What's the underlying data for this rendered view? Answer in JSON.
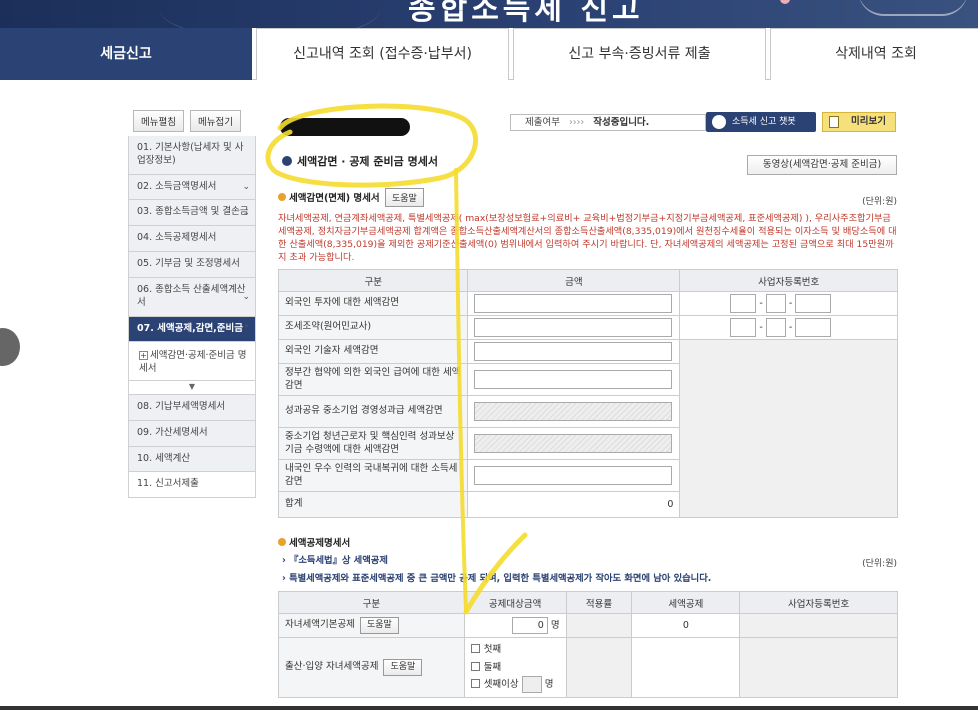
{
  "nav": {
    "tabs": [
      {
        "label": "세금신고",
        "active": true
      },
      {
        "label": "신고내역 조회 (접수증·납부서)"
      },
      {
        "label": "신고 부속·증빙서류 제출"
      },
      {
        "label": "삭제내역 조회"
      }
    ]
  },
  "sidebar": {
    "expand_label": "메뉴펼침",
    "collapse_label": "메뉴접기",
    "items": [
      {
        "label": "01. 기본사항(납세자 및 사업장정보)"
      },
      {
        "label": "02. 소득금액명세서"
      },
      {
        "label": "03. 종합소득금액 및 결손금"
      },
      {
        "label": "04. 소득공제명세서"
      },
      {
        "label": "05. 기부금 및 조정명세서"
      },
      {
        "label": "06. 종합소득 산출세액계산서"
      },
      {
        "label": "07. 세액공제,감면,준비금",
        "active": true
      },
      {
        "label": "세액감면·공제·준비금 명세서"
      },
      {
        "label": "08. 기납부세액명세서"
      },
      {
        "label": "09. 가산세명세서"
      },
      {
        "label": "10. 세액계산"
      },
      {
        "label": "11. 신고서제출"
      }
    ]
  },
  "toolbar": {
    "status_prefix": "제출여부",
    "status_arrows": "››››",
    "status_value": "작성중입니다.",
    "chatbot_label": "소득세 신고 챗봇",
    "preview_label": "미리보기"
  },
  "section": {
    "title": "세액감면 · 공제 준비금 명세서",
    "video_button": "동영상(세액감면·공제 준비금)"
  },
  "reduction": {
    "title": "세액감면(면제) 명세서",
    "help_label": "도움말",
    "unit": "(단위:원)",
    "notice": "자녀세액공제, 연금계좌세액공제, 특별세액공제( max(보장성보험료+의료비+ 교육비+법정기부금+지정기부금세액공제, 표준세액공제) ), 우리사주조합기부금세액공제, 정치자금기부금세액공제 합계액은 종합소득산출세액계산서의 종합소득산출세액(8,335,019)에서 원천징수세율이 적용되는 이자소득 및 배당소득에 대한 산출세액(8,335,019)을 제외한 공제기준산출세액(0) 범위내에서 입력하여 주시기 바랍니다. 단, 자녀세액공제의 세액공제는 고정된 금액으로 최대 15만원까지 초과 가능합니다.",
    "headers": [
      "구분",
      "금액",
      "사업자등록번호"
    ],
    "rows": [
      {
        "label": "외국인 투자에 대한 세액감면"
      },
      {
        "label": "조세조약(원어민교사)"
      },
      {
        "label": "외국인 기술자 세액감면"
      },
      {
        "label": "정부간 협약에 의한 외국인 급여에 대한 세액감면"
      },
      {
        "label": "성과공유 중소기업 경영성과급 세액감면"
      },
      {
        "label": "중소기업 청년근로자 및 핵심인력 성과보상기금 수령액에 대한 세액감면"
      },
      {
        "label": "내국인 우수 인력의 국내복귀에 대한 소득세 감면"
      }
    ],
    "total_label": "합계",
    "total_value": "0"
  },
  "credit": {
    "title": "세액공제명세서",
    "bullet1": "『소득세법』상 세액공제",
    "bullet2": "특별세액공제와 표준세액공제 중 큰 금액만 공제 되며, 입력한 특별세액공제가 작아도 화면에 남아 있습니다.",
    "unit": "(단위:원)",
    "headers": [
      "구분",
      "공제대상금액",
      "적용률",
      "세액공제",
      "사업자등록번호"
    ],
    "row1_label": "자녀세액기본공제",
    "row1_help": "도움말",
    "row1_value": "0",
    "row1_unit": "명",
    "row1_credit": "0",
    "row2_label": "출산·입양 자녀세액공제",
    "row2_help": "도움말",
    "row2_opt1": "첫째",
    "row2_opt2": "둘째",
    "row2_opt3": "셋째이상",
    "row2_unit": "명"
  }
}
